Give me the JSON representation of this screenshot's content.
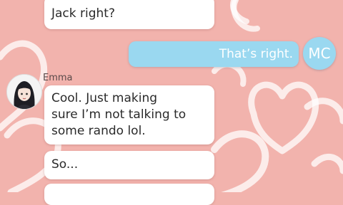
{
  "chat": {
    "messages": [
      {
        "speaker": "",
        "text": "Jack right?"
      },
      {
        "speaker": "MC",
        "text": "That’s right."
      },
      {
        "speaker": "Emma",
        "text": "Cool. Just making\nsure I’m not talking to\nsome rando lol."
      },
      {
        "speaker": "Emma",
        "text": "So..."
      },
      {
        "speaker": "Emma",
        "text": ""
      }
    ],
    "mc_avatar_label": "MC",
    "emma_name": "Emma"
  },
  "colors": {
    "background": "#f2b3ad",
    "hearts": "#ffffff",
    "mc_bubble": "#9ad8f0",
    "other_bubble": "#ffffff"
  },
  "icons": {
    "emma_avatar": "girl-portrait-icon",
    "background": "heart-outline-pattern"
  }
}
